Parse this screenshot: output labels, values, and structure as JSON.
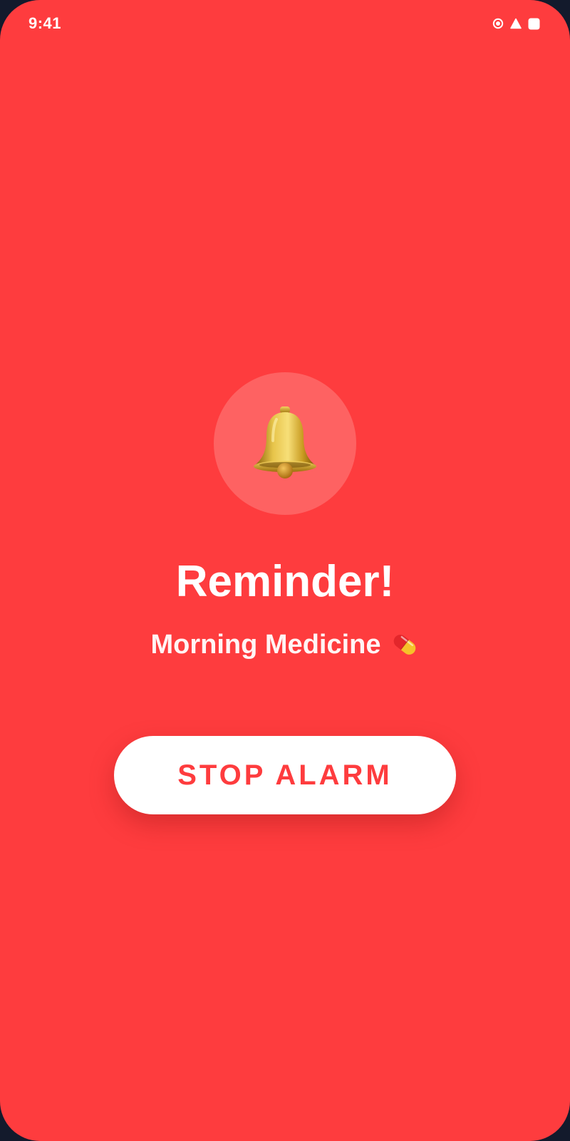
{
  "status_bar": {
    "time": "9:41",
    "icons": [
      "record-icon",
      "signal-icon",
      "battery-icon"
    ]
  },
  "alarm": {
    "icon": "bell-icon",
    "title": "Reminder!",
    "subtitle": "Morning Medicine",
    "subtitle_icon": "pill-icon"
  },
  "actions": {
    "stop_label": "STOP ALARM"
  },
  "colors": {
    "background": "#fe3c3e",
    "bell_circle": "#fe6262",
    "button_background": "#ffffff",
    "button_text": "#fe3c3e",
    "text": "#ffffff",
    "frame": "#131a2c"
  }
}
